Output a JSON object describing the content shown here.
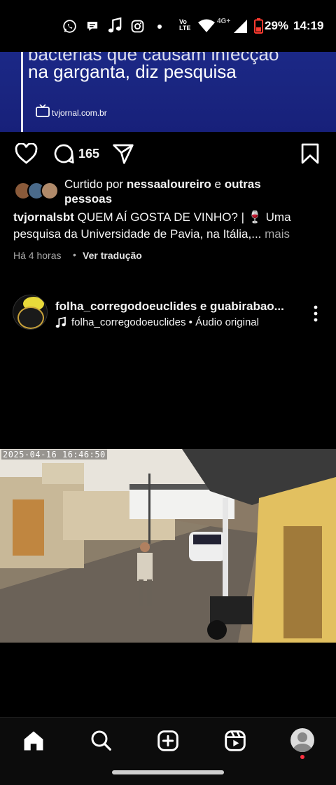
{
  "status_bar": {
    "icons": [
      "whatsapp-icon",
      "chat-bubble-icon",
      "music-note-icon",
      "instagram-icon",
      "dot-icon",
      "volte-icon",
      "wifi-icon",
      "4g-icon",
      "signal-icon",
      "battery-icon"
    ],
    "volte": "Vo LTE",
    "network": "4G+",
    "battery": "29%",
    "time": "14:19"
  },
  "prev_post": {
    "headline_line1": "bactérias que causam infecção",
    "headline_line2": "na garganta, diz pesquisa",
    "source": "tvjornal.com.br",
    "comment_count": "165",
    "liked_by_prefix": "Curtido por ",
    "liked_by_user": "nessaaloureiro",
    "liked_by_mid": " e ",
    "liked_by_others_1": "outras",
    "liked_by_others_2": "pessoas",
    "caption_user": "tvjornalsbt",
    "caption_line1": "QUEM AÍ GOSTA DE VINHO? | 🍷 Uma",
    "caption_line2": "pesquisa da Universidade de Pavia, na Itália,...",
    "more": "mais",
    "time_ago": "Há 4 horas",
    "separator": "•",
    "translate": "Ver tradução"
  },
  "post2": {
    "author_line": "folha_corregodoeuclides e guabirabao...",
    "audio_user": "folha_corregodoeuclides",
    "audio_sep": "•",
    "audio_label": "Áudio original",
    "video_timestamp": "2025-04-16 16:46:50"
  },
  "nav": {
    "items": [
      "home-icon",
      "search-icon",
      "create-icon",
      "reels-icon",
      "profile-avatar"
    ]
  },
  "colors": {
    "news_bg": "#1a2580",
    "notification_dot": "#ff3040"
  }
}
